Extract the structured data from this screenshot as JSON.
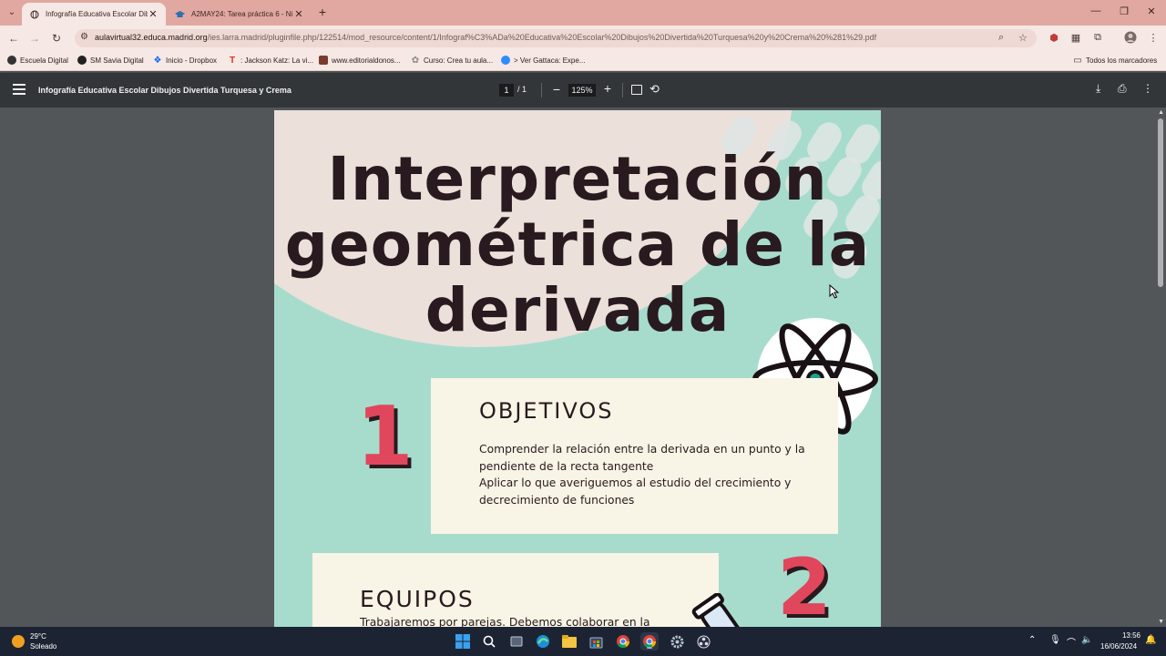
{
  "browser": {
    "tabs": [
      {
        "title": "Infografía Educativa Escolar Dib",
        "active": true
      },
      {
        "title": "A2MAY24: Tarea práctica 6 - Ni",
        "active": false
      }
    ],
    "url_host": "aulavirtual32.educa.madrid.org",
    "url_path": "/ies.larra.madrid/pluginfile.php/122514/mod_resource/content/1/Infograf%C3%ADa%20Educativa%20Escolar%20Dibujos%20Divertida%20Turquesa%20y%20Crema%20%281%29.pdf",
    "bookmarks": [
      {
        "label": "Escuela Digital",
        "icon": "escuela-digital-icon",
        "color": "#333333"
      },
      {
        "label": "SM Savia Digital",
        "icon": "sm-savia-icon",
        "color": "#222222"
      },
      {
        "label": "Inicio - Dropbox",
        "icon": "dropbox-icon",
        "color": "#0061fe"
      },
      {
        "label": ": Jackson Katz: La vi...",
        "icon": "ted-icon",
        "color": "#e62b1e"
      },
      {
        "label": "www.editorialdonos...",
        "icon": "editorial-icon",
        "color": "#7a3b2e"
      },
      {
        "label": "Curso: Crea tu aula...",
        "icon": "curso-icon",
        "color": "#888888"
      },
      {
        "label": "> Ver Gattaca: Expe...",
        "icon": "gattaca-icon",
        "color": "#2d8cff"
      }
    ],
    "all_bookmarks_label": "Todos los marcadores"
  },
  "pdf": {
    "title": "Infografía Educativa Escolar Dibujos Divertida Turquesa y Crema",
    "page_current": "1",
    "page_total": "/ 1",
    "zoom": "125%"
  },
  "document": {
    "title_lines": [
      "Interpretación",
      "geométrica de la",
      "derivada"
    ],
    "sections": [
      {
        "number": "1",
        "heading": "OBJETIVOS",
        "lines": [
          "Comprender la relación entre la derivada en un punto y la",
          "pendiente de la recta tangente",
          "Aplicar lo que averiguemos al estudio del crecimiento y",
          "decrecimiento de funciones"
        ]
      },
      {
        "number": "2",
        "heading": "EQUIPOS",
        "lines": [
          "Trabajaremos por parejas. Debemos colaborar en la"
        ]
      }
    ],
    "colors": {
      "background": "#a7dccd",
      "cream": "#ebe0da",
      "card": "#f8f4e6",
      "accent": "#e0475c",
      "ink": "#281a1e"
    }
  },
  "taskbar": {
    "weather_temp": "29°C",
    "weather_desc": "Soleado",
    "time": "13:56",
    "date": "16/06/2024"
  }
}
